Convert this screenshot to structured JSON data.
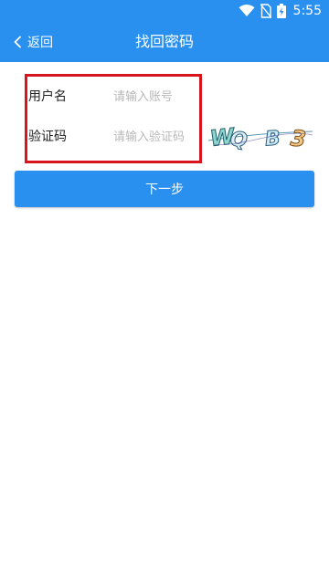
{
  "status_bar": {
    "time": "5:55",
    "icons": [
      "wifi-icon",
      "no-sim-icon",
      "battery-icon"
    ]
  },
  "header": {
    "back_label": "返回",
    "title": "找回密码"
  },
  "form": {
    "username": {
      "label": "用户名",
      "placeholder": "请输入账号",
      "value": ""
    },
    "captcha": {
      "label": "验证码",
      "placeholder": "请输入验证码",
      "value": "",
      "image_text": "WQ B 3"
    }
  },
  "actions": {
    "next_label": "下一步"
  },
  "colors": {
    "primary": "#2a90f0",
    "highlight_border": "#d8141d"
  }
}
